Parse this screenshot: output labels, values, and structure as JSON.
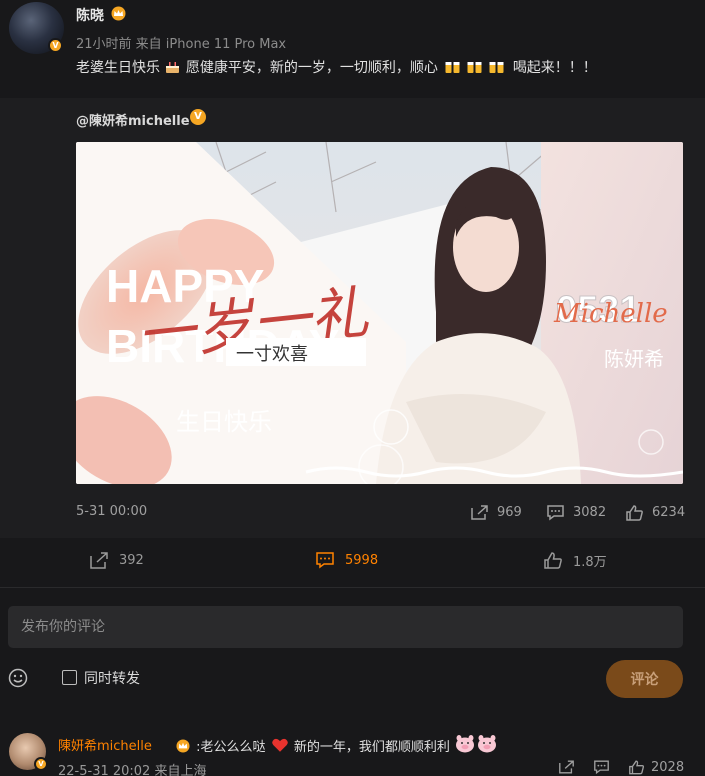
{
  "post": {
    "author": "陈晓",
    "meta": "21小时前  来自 iPhone 11 Pro Max",
    "text_part1": "老婆生日快乐",
    "text_part2": "愿健康平安，新的一岁，一切顺利，顺心",
    "text_part3": "喝起来！！！"
  },
  "repost": {
    "author": "@陳妍希michelle",
    "verified_mark": "V",
    "image": {
      "line1": "HAPPY",
      "line2": "BIRTHDAY",
      "script_overlay": "一岁一礼",
      "subtitle": "一寸欢喜",
      "chinese_greeting": "生日快乐",
      "date_code": "0531",
      "signature": "Michelle",
      "name": "陈妍希"
    },
    "date": "5-31 00:00",
    "shares": "969",
    "comments": "3082",
    "likes": "6234"
  },
  "actions": {
    "shares": "392",
    "comments": "5998",
    "likes": "1.8万"
  },
  "comment_box": {
    "placeholder": "发布你的评论",
    "also_repost_label": "同时转发",
    "submit_label": "评论"
  },
  "comment": {
    "author": "陳妍希michelle",
    "text_a": ":老公么么哒",
    "text_b": " 新的一年，我们都顺顺利利",
    "meta": "22-5-31 20:02  来自上海",
    "likes": "2028"
  },
  "colors": {
    "accent": "#ff8200",
    "background": "#18181a",
    "card": "#1e1e20",
    "verified": "#f5a623"
  },
  "icons": [
    "crown-icon",
    "cake-icon",
    "beer-icon",
    "verified-icon",
    "share-icon",
    "comment-icon",
    "like-icon",
    "emoji-icon",
    "heart-icon",
    "pig-face-icon"
  ]
}
